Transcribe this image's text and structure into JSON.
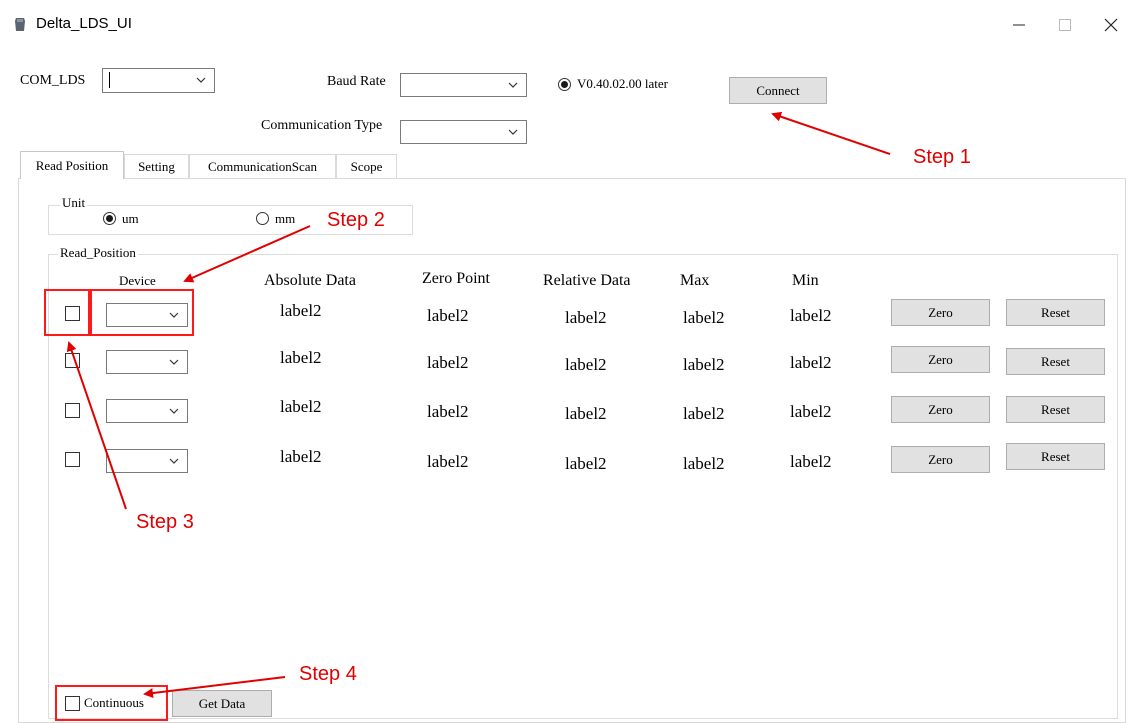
{
  "window": {
    "title": "Delta_LDS_UI",
    "minimize_icon": "minimize-icon",
    "maximize_icon": "maximize-icon",
    "close_icon": "close-icon"
  },
  "connection": {
    "com_label": "COM_LDS",
    "com_value": "",
    "baud_label": "Baud Rate",
    "baud_value": "",
    "comm_type_label": "Communication Type",
    "comm_type_value": "",
    "version_option": "V0.40.02.00 later",
    "connect_button": "Connect"
  },
  "tabs": [
    "Read Position",
    "Setting",
    "CommunicationScan",
    "Scope"
  ],
  "active_tab": "Read Position",
  "unit_group": {
    "title": "Unit",
    "options": [
      "um",
      "mm"
    ],
    "selected": "um"
  },
  "read_position": {
    "title": "Read_Position",
    "headers": {
      "device": "Device",
      "absolute": "Absolute Data",
      "zero_point": "Zero Point",
      "relative": "Relative Data",
      "max": "Max",
      "min": "Min"
    },
    "rows": [
      {
        "absolute": "label2",
        "zero_point": "label2",
        "relative": "label2",
        "max": "label2",
        "min": "label2",
        "zero_button": "Zero",
        "reset_button": "Reset"
      },
      {
        "absolute": "label2",
        "zero_point": "label2",
        "relative": "label2",
        "max": "label2",
        "min": "label2",
        "zero_button": "Zero",
        "reset_button": "Reset"
      },
      {
        "absolute": "label2",
        "zero_point": "label2",
        "relative": "label2",
        "max": "label2",
        "min": "label2",
        "zero_button": "Zero",
        "reset_button": "Reset"
      },
      {
        "absolute": "label2",
        "zero_point": "label2",
        "relative": "label2",
        "max": "label2",
        "min": "label2",
        "zero_button": "Zero",
        "reset_button": "Reset"
      }
    ]
  },
  "bottom": {
    "continuous_label": "Continuous",
    "get_data_button": "Get Data"
  },
  "annotations": {
    "step1": "Step 1",
    "step2": "Step 2",
    "step3": "Step 3",
    "step4": "Step 4",
    "color": "#e00000"
  }
}
